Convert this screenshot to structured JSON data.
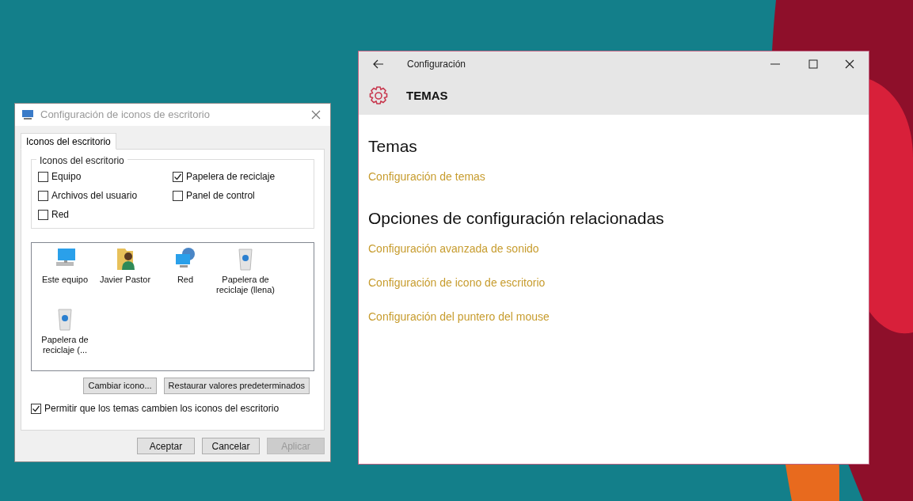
{
  "dialog": {
    "title": "Configuración de iconos de escritorio",
    "tabs": [
      {
        "label": "Iconos del escritorio",
        "selected": true
      }
    ],
    "group_title": "Iconos del escritorio",
    "checkboxes": [
      {
        "label": "Equipo",
        "checked": false
      },
      {
        "label": "Papelera de reciclaje",
        "checked": true
      },
      {
        "label": "Archivos del usuario",
        "checked": false
      },
      {
        "label": "Panel de control",
        "checked": false
      },
      {
        "label": "Red",
        "checked": false
      }
    ],
    "icons": [
      {
        "label": "Este equipo",
        "kind": "computer",
        "selected": false
      },
      {
        "label": "Javier Pastor",
        "kind": "user",
        "selected": false
      },
      {
        "label": "Red",
        "kind": "network",
        "selected": false
      },
      {
        "label": "Papelera de reciclaje (llena)",
        "kind": "bin",
        "selected": false
      },
      {
        "label": "Papelera de reciclaje (...",
        "kind": "bin",
        "selected": false
      }
    ],
    "icon_buttons": [
      "Cambiar icono...",
      "Restaurar valores predeterminados"
    ],
    "theme_checkbox": {
      "label": "Permitir que los temas cambien los iconos del escritorio",
      "checked": true
    },
    "footer_buttons": [
      {
        "label": "Aceptar",
        "disabled": false
      },
      {
        "label": "Cancelar",
        "disabled": false
      },
      {
        "label": "Aplicar",
        "disabled": true
      }
    ]
  },
  "settings": {
    "title": "Configuración",
    "header": "TEMAS",
    "sections": [
      {
        "heading": "Temas",
        "links": [
          "Configuración de temas"
        ]
      },
      {
        "heading": "Opciones de configuración relacionadas",
        "links": [
          "Configuración avanzada de sonido",
          "Configuración de icono de escritorio",
          "Configuración del puntero del mouse"
        ]
      }
    ]
  }
}
